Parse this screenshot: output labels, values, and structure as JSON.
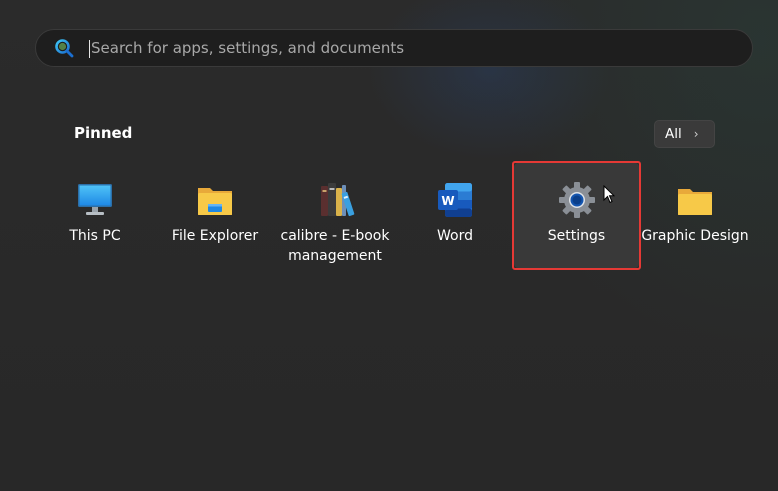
{
  "search": {
    "placeholder": "Search for apps, settings, and documents",
    "value": ""
  },
  "pinned": {
    "title": "Pinned",
    "all_label": "All",
    "apps": [
      {
        "label": "This PC",
        "icon": "monitor-icon"
      },
      {
        "label": "File Explorer",
        "icon": "folder-icon"
      },
      {
        "label": "calibre - E-book management",
        "icon": "books-icon"
      },
      {
        "label": "Word",
        "icon": "word-icon"
      },
      {
        "label": "Settings",
        "icon": "gear-icon"
      },
      {
        "label": "Graphic Design",
        "icon": "folder-icon"
      }
    ]
  },
  "colors": {
    "highlight": "#e53935",
    "accent": "#0078d4",
    "folder": "#f7c948"
  }
}
